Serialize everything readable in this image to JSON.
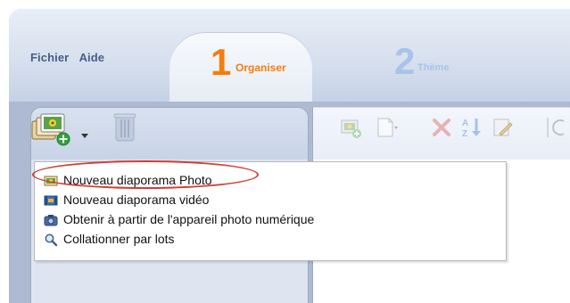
{
  "menubar": {
    "fichier": "Fichier",
    "aide": "Aide"
  },
  "tabs": [
    {
      "number": "1",
      "label": "Organiser",
      "active": true,
      "color": "#f47d0d"
    },
    {
      "number": "2",
      "label": "Thème",
      "active": false,
      "color": "#a8c3ea"
    }
  ],
  "left_toolbar": {
    "add_icon": "photo-stack-add-icon",
    "trash_icon": "trash-icon"
  },
  "right_toolbar": {
    "icons": [
      "add-image-icon",
      "blank-page-dropdown-icon",
      "delete-icon",
      "sort-az-icon",
      "edit-icon",
      "more-icon"
    ]
  },
  "dropdown_menu": {
    "items": [
      {
        "label": "Nouveau diaporama Photo",
        "icon": "photo-slideshow-icon"
      },
      {
        "label": "Nouveau diaporama vidéo",
        "icon": "video-slideshow-icon"
      },
      {
        "label": "Obtenir à partir de l'appareil photo numérique",
        "icon": "camera-icon"
      },
      {
        "label": "Collationner par lots",
        "icon": "magnifier-icon"
      }
    ]
  },
  "colors": {
    "highlight": "#d23c35",
    "menu_text": "#455f86"
  }
}
